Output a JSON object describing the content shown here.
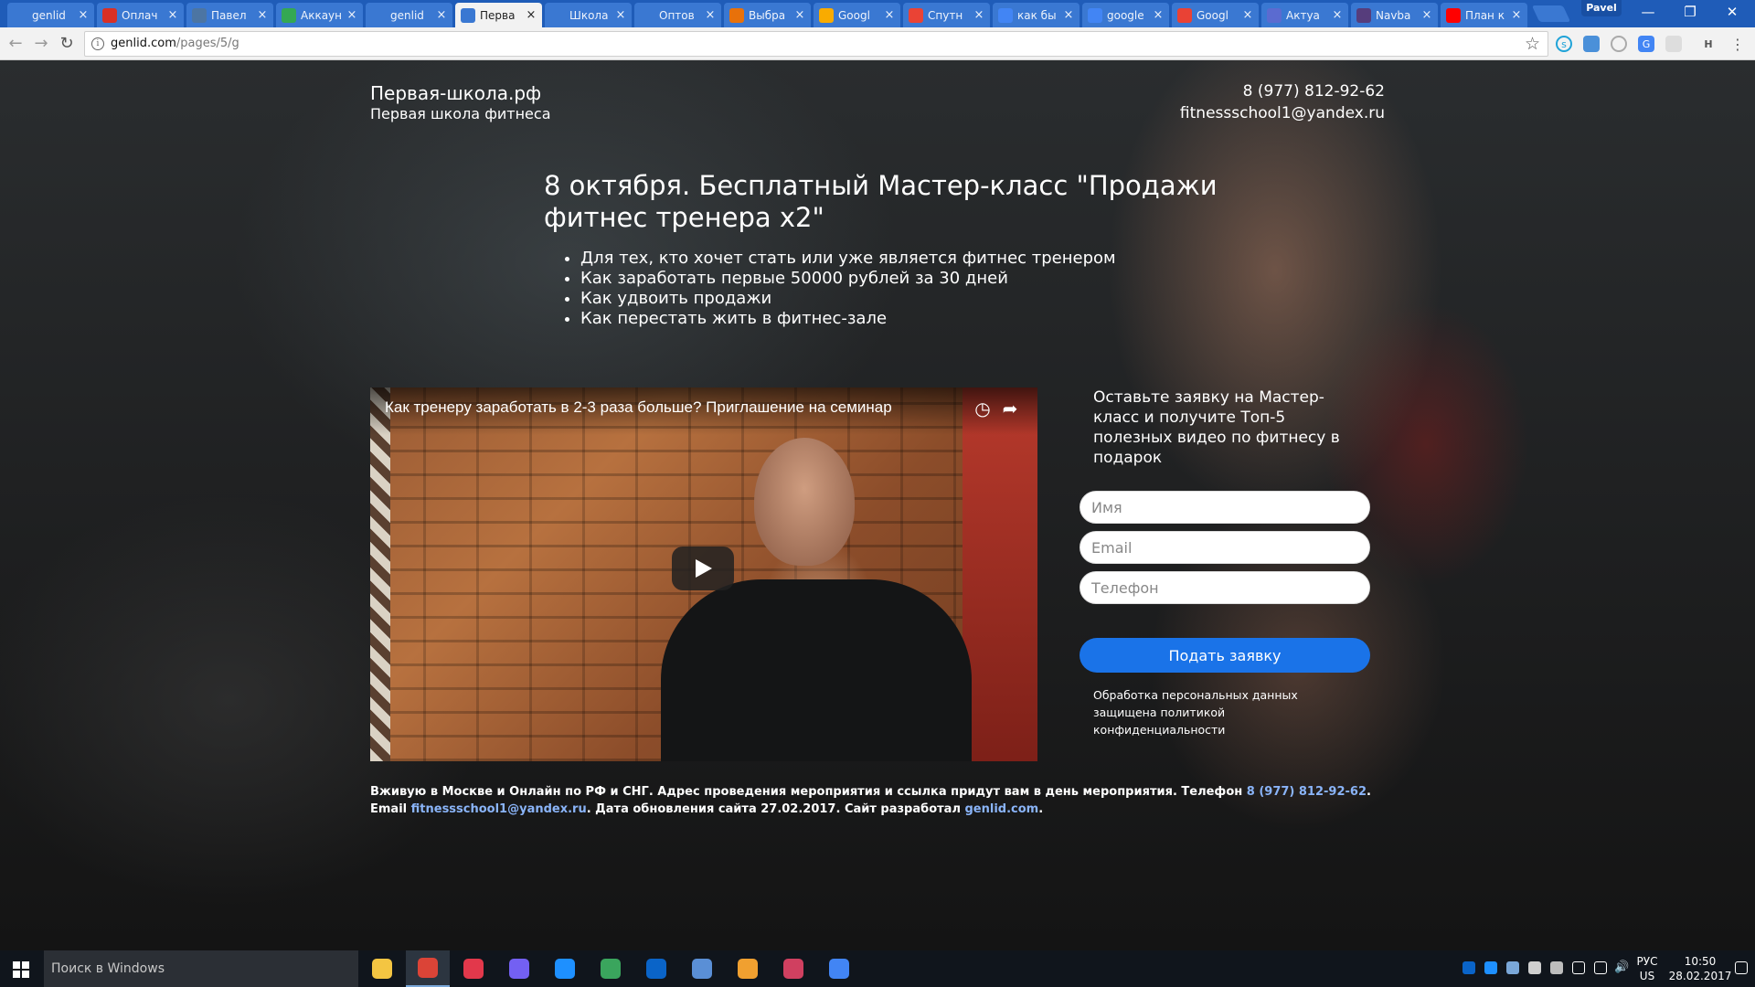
{
  "browser": {
    "tabs": [
      {
        "title": "genlid",
        "favicon": "genlid-icon",
        "color": "#3a78d2",
        "active": false
      },
      {
        "title": "Оплач",
        "favicon": "gmail-icon",
        "color": "#d93025",
        "active": false
      },
      {
        "title": "Павел",
        "favicon": "vk-icon",
        "color": "#4c75a3",
        "active": false
      },
      {
        "title": "Аккаун",
        "favicon": "adwords-icon",
        "color": "#34a853",
        "active": false
      },
      {
        "title": "genlid",
        "favicon": "genlid-icon",
        "color": "#3a78d2",
        "active": false
      },
      {
        "title": "Перва",
        "favicon": "genlid-icon",
        "color": "#3a78d2",
        "active": true
      },
      {
        "title": "Школа",
        "favicon": "genlid-icon",
        "color": "#3a78d2",
        "active": false
      },
      {
        "title": "Оптов",
        "favicon": "genlid-icon",
        "color": "#3a78d2",
        "active": false
      },
      {
        "title": "Выбра",
        "favicon": "analytics-icon",
        "color": "#e8710a",
        "active": false
      },
      {
        "title": "Googl",
        "favicon": "google-tag-icon",
        "color": "#f9ab00",
        "active": false
      },
      {
        "title": "Спутн",
        "favicon": "maps-pin-icon",
        "color": "#ea4335",
        "active": false
      },
      {
        "title": "как бы",
        "favicon": "google-icon",
        "color": "#4285f4",
        "active": false
      },
      {
        "title": "google",
        "favicon": "google-icon",
        "color": "#4285f4",
        "active": false
      },
      {
        "title": "Googl",
        "favicon": "firebase-icon",
        "color": "#e94235",
        "active": false
      },
      {
        "title": "Актуа",
        "favicon": "community-icon",
        "color": "#5b6bd0",
        "active": false
      },
      {
        "title": "Navba",
        "favicon": "bootstrap-icon",
        "color": "#563d7c",
        "active": false
      },
      {
        "title": "План к",
        "favicon": "youtube-icon",
        "color": "#ff0000",
        "active": false
      }
    ],
    "user_name": "Pavel",
    "url_host": "genlid.com",
    "url_path": "/pages/5/g"
  },
  "page": {
    "brand_name": "Первая-школа.рф",
    "brand_subtitle": "Первая школа фитнеса",
    "phone": "8 (977) 812-92-62",
    "email": "fitnessschool1@yandex.ru",
    "headline": "8 октября. Бесплатный Мастер-класс \"Продажи фитнес тренера х2\"",
    "bullets": [
      "Для тех, кто хочет стать или уже является фитнес тренером",
      "Как заработать первые 50000 рублей за 30 дней",
      "Как удвоить продажи",
      "Как перестать жить в фитнес-зале"
    ],
    "video_title": "Как тренеру заработать в 2-3 раза больше? Приглашение на семинар",
    "form_title": "Оставьте заявку на Мастер-класс и получите Топ-5 полезных видео по фитнесу в подарок",
    "form": {
      "name_placeholder": "Имя",
      "email_placeholder": "Email",
      "phone_placeholder": "Телефон",
      "submit_label": "Подать заявку"
    },
    "privacy_text": "Обработка персональных данных защищена политикой конфиденциальности",
    "footer": {
      "part1": "Вживую в Москве и Онлайн по РФ и СНГ. Адрес проведения мероприятия и ссылка придут вам в день мероприятия. Телефон ",
      "phone_link": "8 (977) 812-92-62",
      "part2": ". Email ",
      "email_link": "fitnessschool1@yandex.ru",
      "part3": ". Дата обновления сайта 27.02.2017. Сайт разработал ",
      "site_link": "genlid.com",
      "part4": "."
    },
    "colors": {
      "accent": "#1a73e8",
      "link": "#8ab4f8"
    }
  },
  "taskbar": {
    "search_placeholder": "Поиск в Windows",
    "apps": [
      {
        "name": "file-explorer-icon",
        "color": "#f4c542"
      },
      {
        "name": "chrome-icon",
        "color": "#db4437",
        "active": true
      },
      {
        "name": "opera-icon",
        "color": "#e2384b"
      },
      {
        "name": "viber-icon",
        "color": "#7360f2"
      },
      {
        "name": "edge-icon",
        "color": "#1e90ff"
      },
      {
        "name": "spiral-app-icon",
        "color": "#3aa55d"
      },
      {
        "name": "outlook-icon",
        "color": "#0a64c8"
      },
      {
        "name": "remote-desktop-icon",
        "color": "#5a8fd6"
      },
      {
        "name": "contacts-app-icon",
        "color": "#f0a030"
      },
      {
        "name": "network-app-icon",
        "color": "#d04060"
      },
      {
        "name": "adwords-editor-icon",
        "color": "#4285f4"
      }
    ],
    "lang": "РУС",
    "layout": "US",
    "time": "10:50",
    "date": "28.02.2017"
  }
}
